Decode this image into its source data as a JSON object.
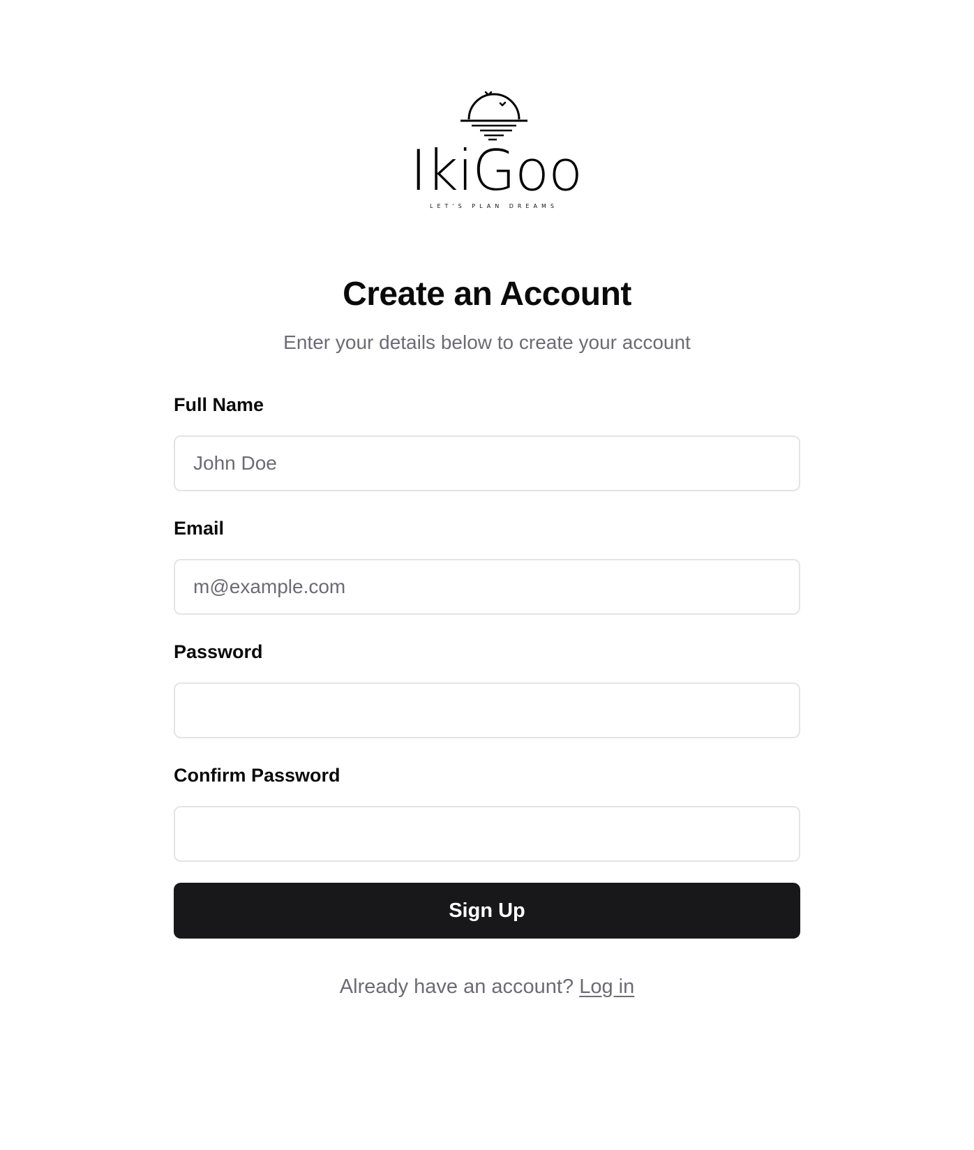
{
  "brand": {
    "name": "IkiGoo",
    "tagline": "LET'S PLAN DREAMS",
    "logo_icon": "sun-over-water-icon"
  },
  "page": {
    "title": "Create an Account",
    "subtitle": "Enter your details below to create your account"
  },
  "form": {
    "full_name": {
      "label": "Full Name",
      "placeholder": "John Doe",
      "value": ""
    },
    "email": {
      "label": "Email",
      "placeholder": "m@example.com",
      "value": ""
    },
    "password": {
      "label": "Password",
      "placeholder": "",
      "value": ""
    },
    "confirm_password": {
      "label": "Confirm Password",
      "placeholder": "",
      "value": ""
    },
    "submit_label": "Sign Up"
  },
  "footer": {
    "prompt": "Already have an account?",
    "login_link": "Log in"
  },
  "colors": {
    "primary_button": "#18181b",
    "muted_text": "#6b6b73",
    "input_border": "#e4e4e7"
  }
}
